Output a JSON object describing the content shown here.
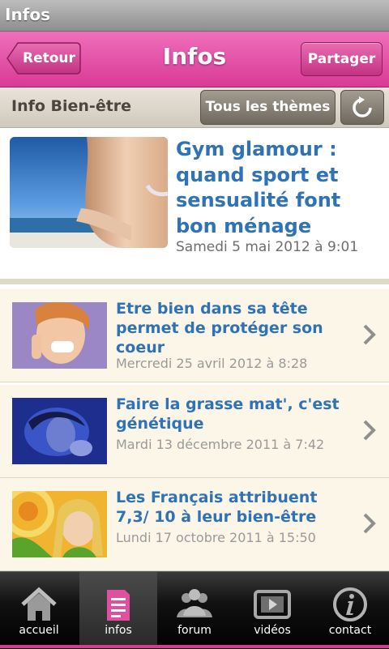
{
  "statusbar": {
    "title": "Infos"
  },
  "navbar": {
    "back_label": "Retour",
    "title": "Infos",
    "share_label": "Partager"
  },
  "subbar": {
    "title": "Info Bien-être",
    "themes_label": "Tous les thèmes"
  },
  "featured": {
    "title": "Gym glamour : quand sport et sensualité font bon ménage",
    "date": "Samedi 5 mai 2012 à 9:01"
  },
  "articles": [
    {
      "title": "Etre bien dans sa tête permet de protéger son coeur",
      "date": "Mercredi 25 avril 2012 à 8:28"
    },
    {
      "title": "Faire la grasse mat', c'est génétique",
      "date": "Mardi 13 décembre 2011 à 7:42"
    },
    {
      "title": "Les Français attribuent 7,3/ 10 à leur bien-être",
      "date": "Lundi 17 octobre 2011 à 15:50"
    }
  ],
  "tabs": [
    {
      "label": "accueil",
      "icon": "home-icon"
    },
    {
      "label": "infos",
      "icon": "document-icon"
    },
    {
      "label": "forum",
      "icon": "people-icon"
    },
    {
      "label": "vidéos",
      "icon": "video-icon"
    },
    {
      "label": "contact",
      "icon": "info-icon"
    }
  ],
  "colors": {
    "accent": "#e0509f",
    "link": "#2f72b5",
    "list_bg": "#fbf6e8"
  }
}
